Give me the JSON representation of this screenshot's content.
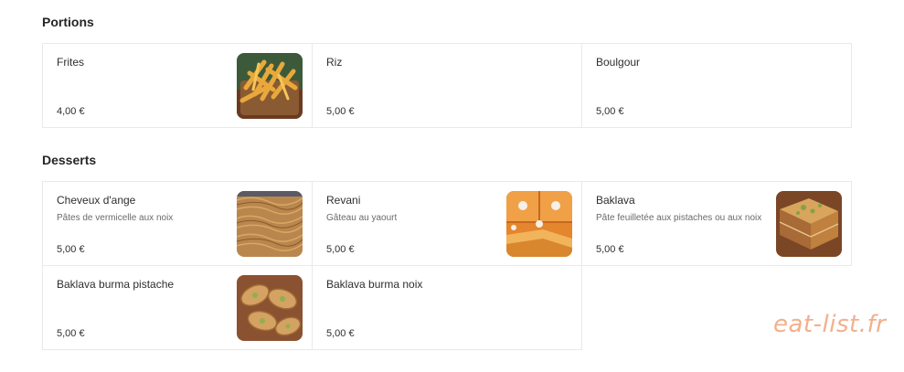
{
  "sections": {
    "portions": {
      "title": "Portions",
      "items": [
        {
          "name": "Frites",
          "description": "",
          "price": "4,00 €",
          "image": "fries-photo"
        },
        {
          "name": "Riz",
          "description": "",
          "price": "5,00 €"
        },
        {
          "name": "Boulgour",
          "description": "",
          "price": "5,00 €"
        }
      ]
    },
    "desserts": {
      "title": "Desserts",
      "items": [
        {
          "name": "Cheveux d'ange",
          "description": "Pâtes de vermicelle aux noix",
          "price": "5,00 €",
          "image": "kadaif-photo"
        },
        {
          "name": "Revani",
          "description": "Gâteau au yaourt",
          "price": "5,00 €",
          "image": "revani-cake-photo"
        },
        {
          "name": "Baklava",
          "description": "Pâte feuilletée aux pistaches ou aux noix",
          "price": "5,00 €",
          "image": "baklava-photo"
        },
        {
          "name": "Baklava burma pistache",
          "description": "",
          "price": "5,00 €",
          "image": "burma-baklava-photo"
        },
        {
          "name": "Baklava burma noix",
          "description": "",
          "price": "5,00 €"
        }
      ]
    }
  },
  "watermark": "eat-list.fr",
  "colors": {
    "watermark": "#f2b08b",
    "card_border": "#e9e9e9",
    "text": "#2e2e2e",
    "muted": "#6a6a6a"
  }
}
